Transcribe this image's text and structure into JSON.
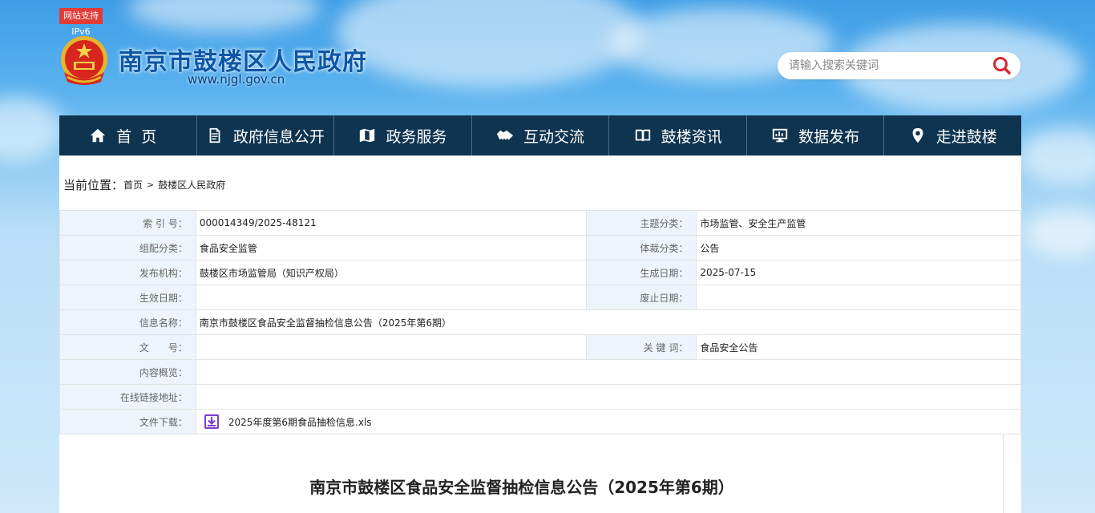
{
  "header": {
    "ipv6_badge": "网站支持IPv6",
    "site_title": "南京市鼓楼区人民政府",
    "site_url": "www.njgl.gov.cn",
    "search_placeholder": "请输入搜索关键词"
  },
  "nav": [
    {
      "label": "首页",
      "icon": "home-icon"
    },
    {
      "label": "政府信息公开",
      "icon": "document-icon"
    },
    {
      "label": "政务服务",
      "icon": "map-icon"
    },
    {
      "label": "互动交流",
      "icon": "handshake-icon"
    },
    {
      "label": "鼓楼资讯",
      "icon": "book-icon"
    },
    {
      "label": "数据发布",
      "icon": "monitor-chart-icon"
    },
    {
      "label": "走进鼓楼",
      "icon": "location-pin-icon"
    }
  ],
  "breadcrumb": {
    "label": "当前位置：",
    "items": [
      "首页",
      "鼓楼区人民政府"
    ],
    "separator": ">"
  },
  "meta": {
    "index_no": {
      "key": "索 引 号：",
      "value": "000014349/2025-48121"
    },
    "topic": {
      "key": "主题分类：",
      "value": "市场监管、安全生产监管"
    },
    "org_category": {
      "key": "组配分类：",
      "value": "食品安全监管"
    },
    "genre": {
      "key": "体裁分类：",
      "value": "公告"
    },
    "publisher": {
      "key": "发布机构：",
      "value": "鼓楼区市场监管局（知识产权局）"
    },
    "created": {
      "key": "生成日期：",
      "value": "2025-07-15"
    },
    "effective": {
      "key": "生效日期：",
      "value": ""
    },
    "abolished": {
      "key": "废止日期：",
      "value": ""
    },
    "info_name": {
      "key": "信息名称：",
      "value": "南京市鼓楼区食品安全监督抽检信息公告（2025年第6期）"
    },
    "doc_no": {
      "key": "文　　号：",
      "value": ""
    },
    "keywords": {
      "key": "关 键 词：",
      "value": "食品安全公告"
    },
    "summary": {
      "key": "内容概览：",
      "value": ""
    },
    "online_link": {
      "key": "在线链接地址：",
      "value": ""
    },
    "download": {
      "key": "文件下载：",
      "value": "2025年度第6期食品抽检信息.xls"
    }
  },
  "article": {
    "title": "南京市鼓楼区食品安全监督抽检信息公告（2025年第6期）"
  },
  "colors": {
    "nav_bg": "#0f3450",
    "title_blue": "#0d56a6",
    "badge_red": "#e23b36",
    "label_bg": "#eef4fb",
    "download_icon": "#7b3fd0"
  }
}
